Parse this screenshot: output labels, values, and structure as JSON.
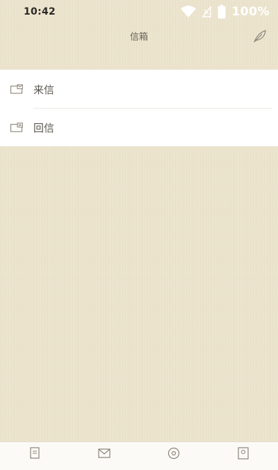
{
  "status_bar": {
    "time": "10:42",
    "battery_text": "100%"
  },
  "header": {
    "title": "信箱",
    "compose_icon": "feather-pen-icon"
  },
  "mailbox": {
    "items": [
      {
        "label": "来信",
        "icon": "inbox-envelope-icon"
      },
      {
        "label": "回信",
        "icon": "reply-envelope-icon"
      }
    ]
  },
  "tab_bar": {
    "icons": [
      "document-icon",
      "mail-icon",
      "compass-icon",
      "profile-icon"
    ]
  },
  "colors": {
    "background": "#ebe3cc",
    "list_background": "#ffffff",
    "text_primary": "#5a5650",
    "title_text": "#6a6358",
    "icon_color": "#8a8377"
  }
}
